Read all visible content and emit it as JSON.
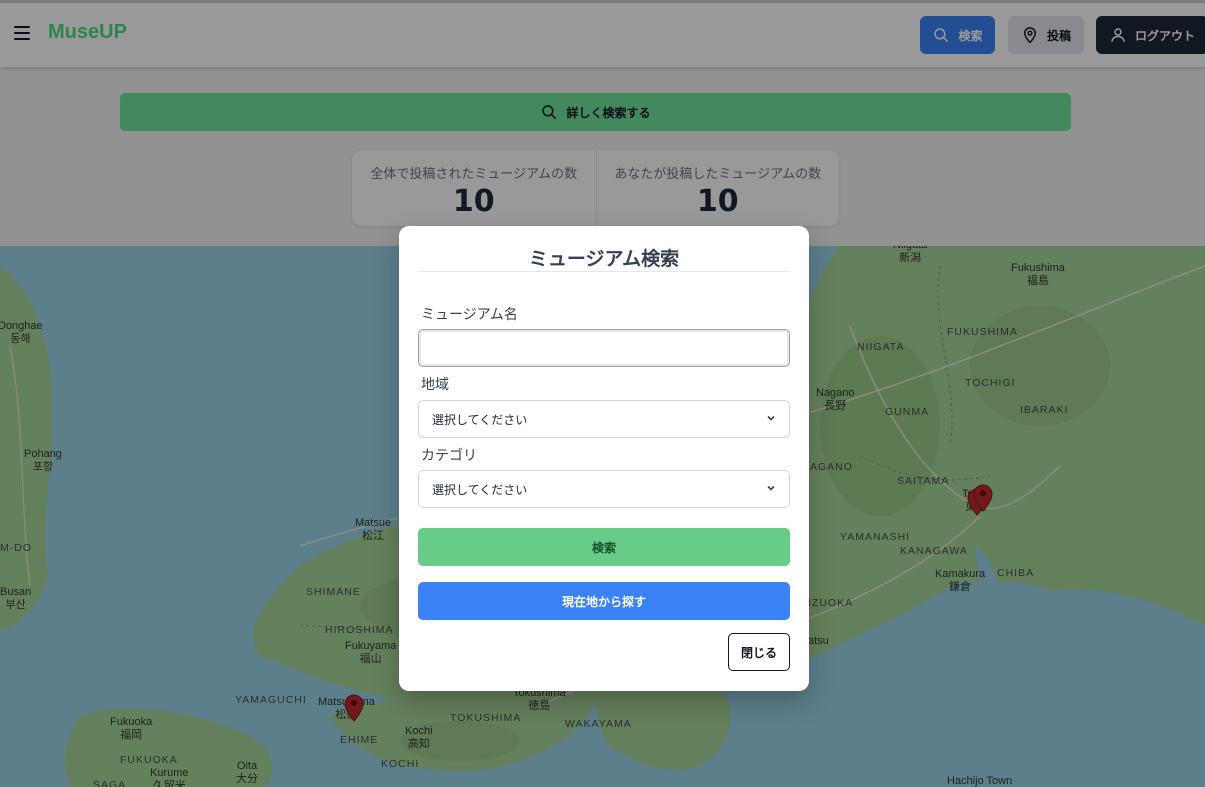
{
  "header": {
    "logo": "MuseUP",
    "search_button": "検索",
    "post_button": "投稿",
    "logout_button": "ログアウト"
  },
  "advanced_search": {
    "label": "詳しく検索する"
  },
  "stats": [
    {
      "label": "全体で投稿されたミュージアムの数",
      "value": "10"
    },
    {
      "label": "あなたが投稿したミュージアムの数",
      "value": "10"
    }
  ],
  "map": {
    "labels": {
      "niigata_city": "Niigata\n新潟",
      "fukushima_city": "Fukushima\n福島",
      "donghae": "Donghae\n동해",
      "fukushima_pref": "FUKUSHIMA",
      "niigata_pref": "NIIGATA",
      "tochigi": "TOCHIGI",
      "nagano": "Nagano\n長野",
      "gunma": "GUNMA",
      "ibaraki": "IBARAKI",
      "pohang": "Pohang\n포항",
      "nagano_pref": "AGANO",
      "saitama": "SAITAMA",
      "tokyo": "Tokyo\n東京",
      "matsue": "Matsue\n松江",
      "yamanashi": "YAMANASHI",
      "kanagawa": "KANAGAWA",
      "m_do": "M-DO",
      "kamakura": "Kamakura\n鎌倉",
      "chiba": "CHIBA",
      "busan": "Busan\n부산",
      "shimane": "SHIMANE",
      "hiroshima": "HIROSHIMA",
      "shizuoka": "IZUOKA",
      "tsu": "atsu",
      "fukuyama": "Fukuyama\n福山",
      "yamaguchi": "YAMAGUCHI",
      "matsuyama": "Matsuyama\n松山",
      "tokushima_city": "Tokushima\n徳島",
      "fukuoka": "Fukuoka\n福岡",
      "tokushima_pref": "TOKUSHIMA",
      "wakayama": "WAKAYAMA",
      "ehime": "EHIME",
      "kochi_city": "Kochi\n高知",
      "fukuoka_pref": "FUKUOKA",
      "kurume": "Kurume\n久留米",
      "kochi_pref": "KOCHI",
      "oita": "Oita\n大分",
      "saga": "SAGA",
      "hachijo": "Hachijo Town"
    }
  },
  "modal": {
    "title": "ミュージアム検索",
    "name_label": "ミュージアム名",
    "name_value": "",
    "region_label": "地域",
    "region_selected": "選択してください",
    "category_label": "カテゴリ",
    "category_selected": "選択してください",
    "search_button": "検索",
    "location_button": "現在地から探す",
    "close_button": "閉じる"
  },
  "colors": {
    "brand": "#4ade80",
    "primary": "#3b82f6",
    "search_green": "#66cc88",
    "dark": "#1f2937",
    "sea": "#9ad4e8",
    "land": "#a9d59a"
  },
  "icons": {
    "menu": "hamburger-icon",
    "search": "search-icon",
    "post": "map-pin-icon",
    "logout": "user-icon",
    "select": "chevron-down-icon",
    "marker": "map-marker-icon"
  }
}
